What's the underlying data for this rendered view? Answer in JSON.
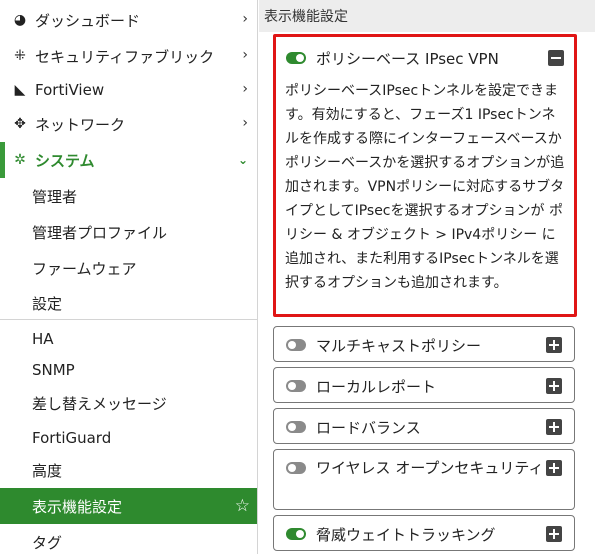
{
  "sidebar": {
    "items": [
      {
        "label": "ダッシュボード",
        "icon": "dashboard-icon",
        "glyph": "◕",
        "chevron": "›"
      },
      {
        "label": "セキュリティファブリック",
        "icon": "security-fabric-icon",
        "glyph": "⁜",
        "chevron": "›"
      },
      {
        "label": "FortiView",
        "icon": "fortiview-icon",
        "glyph": "◣",
        "chevron": "›"
      },
      {
        "label": "ネットワーク",
        "icon": "network-icon",
        "glyph": "✥",
        "chevron": "›"
      },
      {
        "label": "システム",
        "icon": "gear-icon",
        "glyph": "✲",
        "chevron": "⌄"
      }
    ],
    "sub_items": [
      {
        "label": "管理者"
      },
      {
        "label": "管理者プロファイル"
      },
      {
        "label": "ファームウェア"
      },
      {
        "label": "設定"
      },
      {
        "label": "HA"
      },
      {
        "label": "SNMP"
      },
      {
        "label": "差し替えメッセージ"
      },
      {
        "label": "FortiGuard"
      },
      {
        "label": "高度"
      },
      {
        "label": "表示機能設定",
        "active": true,
        "star": "☆"
      },
      {
        "label": "タグ"
      }
    ]
  },
  "main": {
    "header": "表示機能設定",
    "features": [
      {
        "title": "ポリシーベース IPsec VPN",
        "enabled": true,
        "expanded": true,
        "description": "ポリシーベースIPsecトンネルを設定できます。有効にすると、フェーズ1 IPsecトンネルを作成する際にインターフェースベースかポリシーベースかを選択するオプションが追加されます。VPNポリシーに対応するサブタイプとしてIPsecを選択するオプションが ポリシー & オブジェクト > IPv4ポリシー に追加され、また利用するIPsecトンネルを選択するオプションも追加されます。"
      },
      {
        "title": "マルチキャストポリシー",
        "enabled": false
      },
      {
        "title": "ローカルレポート",
        "enabled": false
      },
      {
        "title": "ロードバランス",
        "enabled": false
      },
      {
        "title": "ワイヤレス オープンセキュリティ",
        "enabled": false
      },
      {
        "title": "脅威ウェイトトラッキング",
        "enabled": true
      }
    ]
  },
  "colors": {
    "accent_green": "#2e8a2e",
    "highlight_red": "#e01515",
    "toggle_off": "#8a8a8a"
  }
}
